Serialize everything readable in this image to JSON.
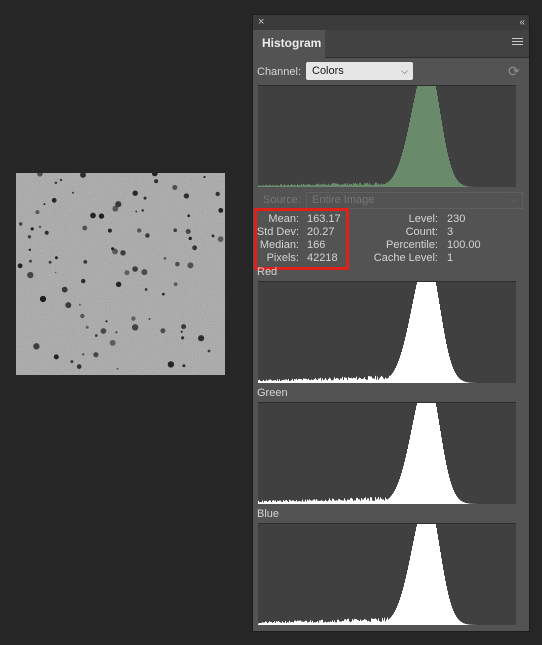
{
  "panel": {
    "close_glyph": "×",
    "collapse_glyph": "«",
    "tab_label": "Histogram",
    "menu_icon": "hamburger-menu-icon"
  },
  "channel": {
    "label": "Channel:",
    "selected": "Colors",
    "refresh_icon": "refresh-icon"
  },
  "source": {
    "label": "Source:",
    "selected": "Entire Image"
  },
  "stats": {
    "mean_label": "Mean:",
    "mean": "163.17",
    "std_label": "Std Dev:",
    "std": "20.27",
    "median_label": "Median:",
    "median": "166",
    "pixels_label": "Pixels:",
    "pixels": "42218",
    "level_label": "Level:",
    "level": "230",
    "count_label": "Count:",
    "count": "3",
    "percentile_label": "Percentile:",
    "percentile": "100.00",
    "cache_label": "Cache Level:",
    "cache": "1"
  },
  "channels": {
    "red": "Red",
    "green": "Green",
    "blue": "Blue"
  },
  "colors": {
    "composite_fill": "#6a8a6c",
    "channel_fill": "#ffffff",
    "highlight": "#e0201a"
  }
}
